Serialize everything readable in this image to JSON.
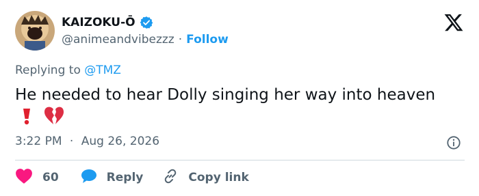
{
  "author": {
    "display_name": "KAIZOKU-Ō",
    "handle": "@animeandvibezzz",
    "separator": "·",
    "follow_label": "Follow",
    "verified_icon": "verified-badge-icon"
  },
  "reply_context": {
    "prefix": "Replying to ",
    "mention": "@TMZ"
  },
  "tweet": {
    "text": "He needed to hear Dolly singing her way into heaven",
    "emojis": [
      "heavy-exclamation-mark",
      "broken-heart"
    ]
  },
  "meta": {
    "time": "3:22 PM",
    "separator": "·",
    "date": "Aug 26, 2026"
  },
  "actions": {
    "like_count": "60",
    "reply_label": "Reply",
    "copy_label": "Copy link"
  },
  "colors": {
    "accent": "#1d9bf0",
    "like": "#f91880",
    "muted": "#536471",
    "text": "#0f1419"
  }
}
